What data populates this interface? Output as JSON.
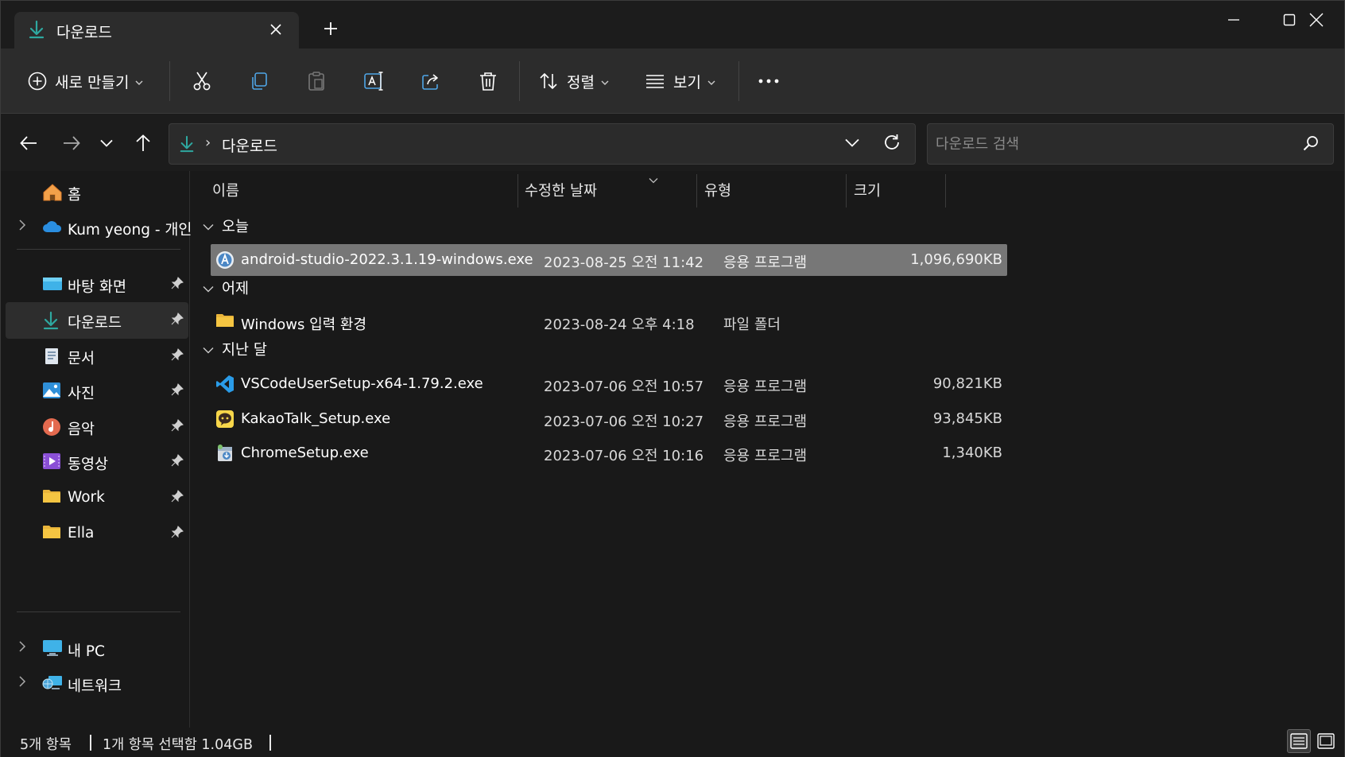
{
  "tab": {
    "title": "다운로드",
    "icon": "download-icon"
  },
  "window_controls": [
    "minimize-icon",
    "maximize-icon",
    "close-icon"
  ],
  "toolbar": {
    "new_label": "새로 만들기",
    "sort_label": "정렬",
    "view_label": "보기",
    "icons": [
      "cut-icon",
      "copy-icon",
      "paste-icon",
      "rename-icon",
      "share-icon",
      "delete-icon",
      "more-icon"
    ]
  },
  "address": {
    "crumb": "다운로드",
    "search_placeholder": "다운로드 검색"
  },
  "sidebar": {
    "items": [
      {
        "label": "홈",
        "icon": "home-icon"
      },
      {
        "label": "Kum yeong - 개인",
        "icon": "onedrive-cloud-icon"
      },
      {
        "label": "바탕 화면",
        "icon": "desktop-icon"
      },
      {
        "label": "다운로드",
        "icon": "download-icon"
      },
      {
        "label": "문서",
        "icon": "documents-icon"
      },
      {
        "label": "사진",
        "icon": "pictures-icon"
      },
      {
        "label": "음악",
        "icon": "music-icon"
      },
      {
        "label": "동영상",
        "icon": "videos-icon"
      },
      {
        "label": "Work",
        "icon": "folder-icon"
      },
      {
        "label": "Ella",
        "icon": "folder-icon"
      },
      {
        "label": "내 PC",
        "icon": "pc-icon"
      },
      {
        "label": "네트워크",
        "icon": "network-icon"
      }
    ]
  },
  "columns": {
    "name": "이름",
    "date": "수정한 날짜",
    "type": "유형",
    "size": "크기"
  },
  "groups": [
    {
      "label": "오늘",
      "files": [
        {
          "name": "android-studio-2022.3.1.19-windows.exe",
          "date": "2023-08-25 오전 11:42",
          "type": "응용 프로그램",
          "size": "1,096,690KB",
          "icon": "android-studio-icon",
          "selected": true
        }
      ]
    },
    {
      "label": "어제",
      "files": [
        {
          "name": "Windows 입력 환경",
          "date": "2023-08-24 오후 4:18",
          "type": "파일 폴더",
          "size": "",
          "icon": "folder-icon"
        }
      ]
    },
    {
      "label": "지난 달",
      "files": [
        {
          "name": "VSCodeUserSetup-x64-1.79.2.exe",
          "date": "2023-07-06 오전 10:57",
          "type": "응용 프로그램",
          "size": "90,821KB",
          "icon": "vscode-icon"
        },
        {
          "name": "KakaoTalk_Setup.exe",
          "date": "2023-07-06 오전 10:27",
          "type": "응용 프로그램",
          "size": "93,845KB",
          "icon": "kakaotalk-icon"
        },
        {
          "name": "ChromeSetup.exe",
          "date": "2023-07-06 오전 10:16",
          "type": "응용 프로그램",
          "size": "1,340KB",
          "icon": "installer-icon"
        }
      ]
    }
  ],
  "status": {
    "item_count": "5개 항목",
    "selection": "1개 항목 선택함 1.04GB"
  },
  "colors": {
    "accent_download": "#2ea8a0",
    "folder": "#f5c542",
    "selected_row": "#777777"
  }
}
